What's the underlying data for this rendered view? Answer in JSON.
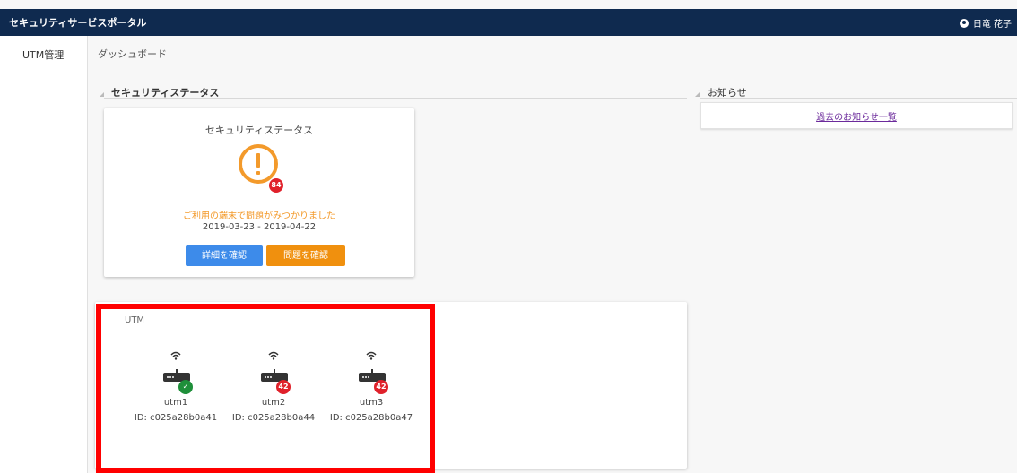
{
  "header": {
    "app_title": "セキュリティサービスポータル",
    "user_name": "日竜 花子",
    "background_color": "#0f2a4f"
  },
  "sidebar": {
    "items": [
      {
        "label": "UTM管理"
      }
    ]
  },
  "breadcrumb": "ダッシュボード",
  "security_status": {
    "section_title": "セキュリティステータス",
    "card_title": "セキュリティステータス",
    "alert_count": "84",
    "message": "ご利用の端末で問題がみつかりました",
    "date_range": "2019-03-23 - 2019-04-22",
    "detail_button": "詳細を確認",
    "issue_button": "問題を確認",
    "colors": {
      "warning": "#f39a2b",
      "badge": "#e0212b",
      "detail": "#3d8bea",
      "issue": "#f0900e"
    }
  },
  "utm": {
    "title": "UTM",
    "devices": [
      {
        "name": "utm1",
        "id": "ID: c025a28b0a41",
        "status": "ok",
        "badge": ""
      },
      {
        "name": "utm2",
        "id": "ID: c025a28b0a44",
        "status": "alert",
        "badge": "42"
      },
      {
        "name": "utm3",
        "id": "ID: c025a28b0a47",
        "status": "alert",
        "badge": "42"
      }
    ]
  },
  "notices": {
    "section_title": "お知らせ",
    "past_link": "過去のお知らせ一覧"
  },
  "annotation": {
    "highlight_color": "#ff0000"
  }
}
